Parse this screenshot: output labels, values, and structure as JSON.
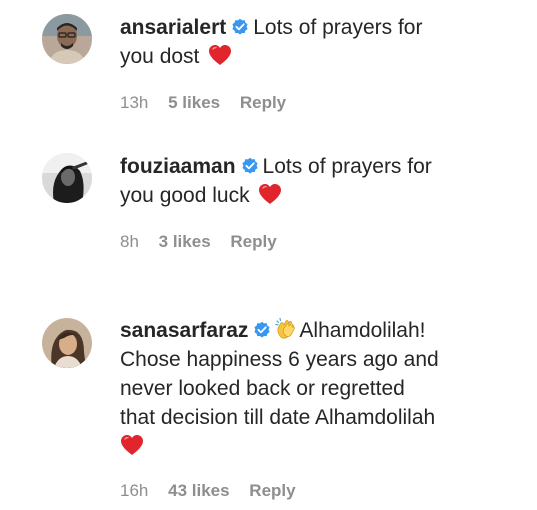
{
  "comments": [
    {
      "username": "ansarialert",
      "verified": true,
      "text_lines": [
        "Lots of prayers for",
        "you dost"
      ],
      "emoji": "red-heart",
      "time": "13h",
      "likes": "5 likes",
      "reply_label": "Reply"
    },
    {
      "username": "fouziaaman",
      "verified": true,
      "text_lines": [
        "Lots of prayers for",
        "you good luck"
      ],
      "emoji": "red-heart",
      "time": "8h",
      "likes": "3 likes",
      "reply_label": "Reply"
    },
    {
      "username": "sanasarfaraz",
      "verified": true,
      "text_lines": [
        "Alhamdolilah!",
        "Chose happiness 6 years ago and",
        "never looked back or regretted",
        "that decision till date Alhamdolilah"
      ],
      "emoji": "red-heart",
      "lead_emoji": "clapping-hands",
      "time": "16h",
      "likes": "43 likes",
      "reply_label": "Reply"
    }
  ],
  "colors": {
    "text": "#262626",
    "meta": "#8e8e8e",
    "verified_blue": "#3897f0",
    "heart_red": "#e0262c"
  }
}
